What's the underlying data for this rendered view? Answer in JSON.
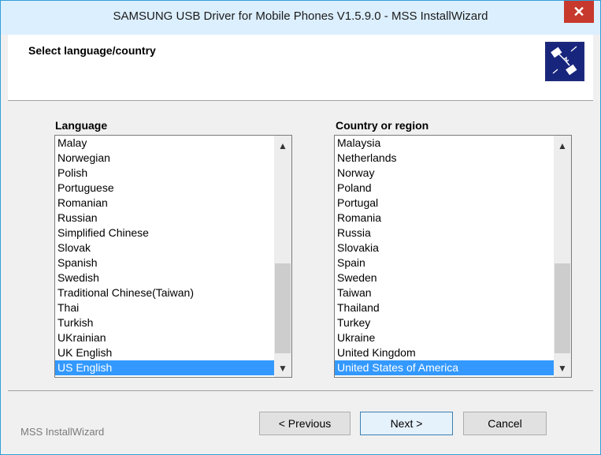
{
  "window": {
    "title": "SAMSUNG USB Driver for Mobile Phones V1.5.9.0 - MSS InstallWizard",
    "close_symbol": "✕"
  },
  "header": {
    "title": "Select language/country",
    "logo_icon": "usb-transfer-icon"
  },
  "language_list": {
    "label": "Language",
    "items": [
      "Malay",
      "Norwegian",
      "Polish",
      "Portuguese",
      "Romanian",
      "Russian",
      "Simplified Chinese",
      "Slovak",
      "Spanish",
      "Swedish",
      "Traditional Chinese(Taiwan)",
      "Thai",
      "Turkish",
      "UKrainian",
      "UK English",
      "US English"
    ],
    "selected": "US English"
  },
  "country_list": {
    "label": "Country or region",
    "items": [
      "Malaysia",
      "Netherlands",
      "Norway",
      "Poland",
      "Portugal",
      "Romania",
      "Russia",
      "Slovakia",
      "Spain",
      "Sweden",
      "Taiwan",
      "Thailand",
      "Turkey",
      "Ukraine",
      "United Kingdom",
      "United States of America"
    ],
    "selected": "United States of America"
  },
  "footer": {
    "brand": "MSS InstallWizard",
    "previous_label": "< Previous",
    "next_label": "Next >",
    "cancel_label": "Cancel"
  },
  "colors": {
    "selection": "#3399ff",
    "titlebar": "#dcefff",
    "close": "#c7392c"
  }
}
